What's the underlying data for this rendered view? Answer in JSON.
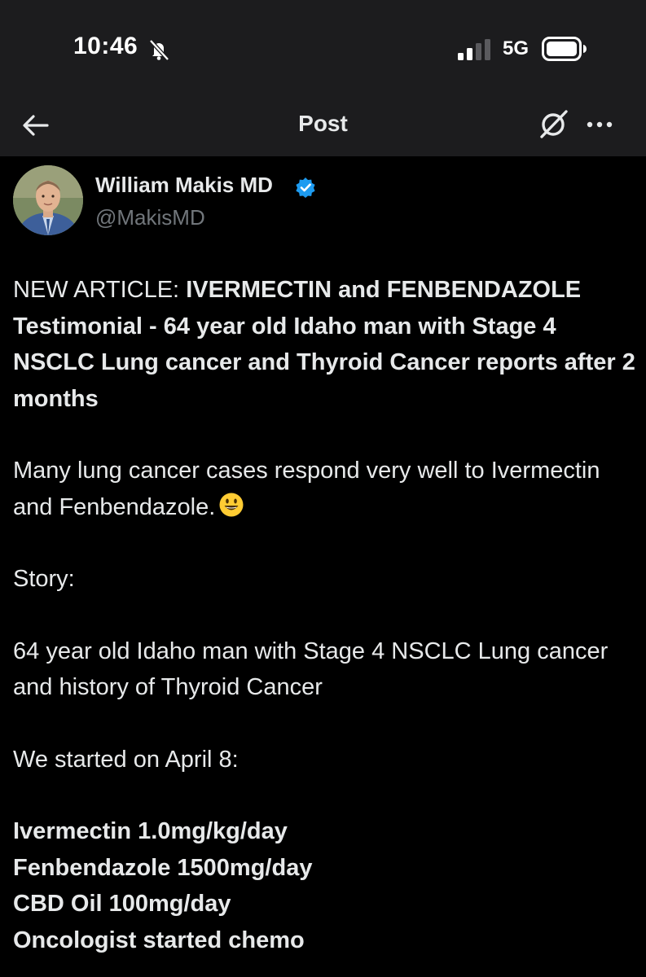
{
  "status_bar": {
    "time": "10:46",
    "network": "5G",
    "icons": [
      "bell-off-icon",
      "signal-icon",
      "battery-icon"
    ]
  },
  "nav": {
    "title": "Post",
    "icons": [
      "back-arrow-icon",
      "grok-icon",
      "more-icon"
    ]
  },
  "author": {
    "name": "William Makis MD",
    "handle": "@MakisMD",
    "verified": true,
    "verified_color": "#1d9bf0"
  },
  "post": {
    "intro_prefix": "NEW ARTICLE: ",
    "intro_bold": "IVERMECTIN and FENBENDAZOLE Testimonial - 64 year old Idaho man with Stage 4 NSCLC Lung cancer and Thyroid Cancer reports after 2 months",
    "para2": "Many lung cancer cases respond very well to Ivermectin and Fenbendazole.",
    "para2_emoji": "smiling-face-emoji",
    "para3": "Story:",
    "para4": "64 year old Idaho man with Stage 4 NSCLC Lung cancer and history of Thyroid Cancer",
    "para5": "We started on April 8:",
    "regimen": [
      "Ivermectin 1.0mg/kg/day",
      "Fenbendazole 1500mg/day",
      "CBD Oil 100mg/day",
      "Oncologist started chemo"
    ]
  },
  "colors": {
    "background": "#000000",
    "bar_background": "#1c1c1e",
    "text": "#e7e9ea",
    "secondary_text": "#71767b",
    "accent": "#1d9bf0"
  }
}
